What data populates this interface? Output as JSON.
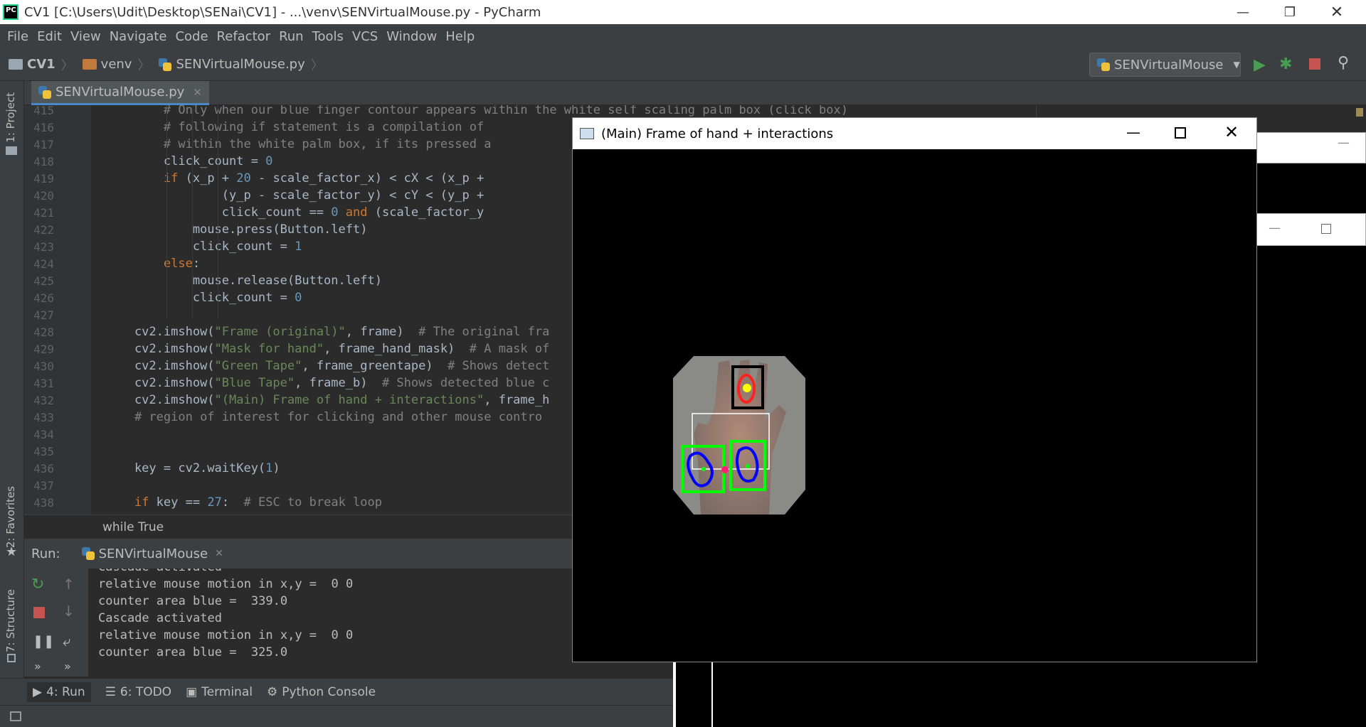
{
  "window": {
    "title": "CV1 [C:\\Users\\Udit\\Desktop\\SENai\\CV1] - ...\\venv\\SENVirtualMouse.py - PyCharm",
    "app_icon": "pycharm-logo-icon"
  },
  "menu": [
    "File",
    "Edit",
    "View",
    "Navigate",
    "Code",
    "Refactor",
    "Run",
    "Tools",
    "VCS",
    "Window",
    "Help"
  ],
  "breadcrumbs": [
    "CV1",
    "venv",
    "SENVirtualMouse.py"
  ],
  "run_config": "SENVirtualMouse",
  "side_tabs": {
    "project": "1: Project",
    "favorites": "2: Favorites",
    "structure": "7: Structure"
  },
  "editor": {
    "tab": "SENVirtualMouse.py",
    "lines": [
      {
        "n": "415",
        "html": "        <span class='cm'># Only when our blue finger contour appears within the white self scaling palm box (click box)</span>"
      },
      {
        "n": "416",
        "html": "        <span class='cm'># following if statement is a compilation of</span>"
      },
      {
        "n": "417",
        "html": "        <span class='cm'># within the white palm box, if its pressed a</span>"
      },
      {
        "n": "418",
        "html": "        click_count = <span class='nm'>0</span>"
      },
      {
        "n": "419",
        "html": "        <span class='kw'>if</span> (x_p + <span class='nm'>20</span> - scale_factor_x) &lt; cX &lt; (x_p +"
      },
      {
        "n": "420",
        "html": "                (y_p - scale_factor_y) &lt; cY &lt; (y_p +"
      },
      {
        "n": "421",
        "html": "                click_count == <span class='nm'>0</span> <span class='kw'>and</span> (scale_factor_y"
      },
      {
        "n": "422",
        "html": "            mouse.press(Button.left)"
      },
      {
        "n": "423",
        "html": "            click_count = <span class='nm'>1</span>"
      },
      {
        "n": "424",
        "html": "        <span class='kw'>else</span>:"
      },
      {
        "n": "425",
        "html": "            mouse.release(Button.left)"
      },
      {
        "n": "426",
        "html": "            click_count = <span class='nm'>0</span>"
      },
      {
        "n": "427",
        "html": ""
      },
      {
        "n": "428",
        "html": "    cv2.imshow(<span class='st'>\"Frame (original)\"</span>, frame)  <span class='cm'># The original fra</span>"
      },
      {
        "n": "429",
        "html": "    cv2.imshow(<span class='st'>\"Mask for hand\"</span>, frame_hand_mask)  <span class='cm'># A mask of</span>"
      },
      {
        "n": "430",
        "html": "    cv2.imshow(<span class='st'>\"Green Tape\"</span>, frame_greentape)  <span class='cm'># Shows detect</span>"
      },
      {
        "n": "431",
        "html": "    cv2.imshow(<span class='st'>\"Blue Tape\"</span>, frame_b)  <span class='cm'># Shows detected blue c</span>"
      },
      {
        "n": "432",
        "html": "    cv2.imshow(<span class='st'>\"(Main) Frame of hand + interactions\"</span>, frame_h"
      },
      {
        "n": "433",
        "html": "    <span class='cm'># region of interest for clicking and other mouse contro</span>"
      },
      {
        "n": "434",
        "html": ""
      },
      {
        "n": "435",
        "html": ""
      },
      {
        "n": "436",
        "html": "    key = cv2.waitKey(<span class='nm'>1</span>)"
      },
      {
        "n": "437",
        "html": ""
      },
      {
        "n": "438",
        "html": "    <span class='kw'>if</span> key == <span class='nm'>27</span>:  <span class='cm'># ESC to break loop</span>"
      }
    ]
  },
  "code_breadcrumb": "while True",
  "run_panel": {
    "label": "Run:",
    "tab": "SENVirtualMouse",
    "output": [
      "Cascade activated",
      "relative mouse motion in x,y =  0 0",
      "counter area blue =  339.0",
      "Cascade activated",
      "relative mouse motion in x,y =  0 0",
      "counter area blue =  325.0"
    ]
  },
  "bottom_tabs": [
    {
      "label": "4: Run",
      "icon": "run-icon"
    },
    {
      "label": "6: TODO",
      "icon": "todo-icon"
    },
    {
      "label": "Terminal",
      "icon": "terminal-icon"
    },
    {
      "label": "Python Console",
      "icon": "python-console-icon"
    }
  ],
  "cv_window": {
    "title": "(Main) Frame of hand + interactions"
  },
  "colors": {
    "accent": "#4a88c7",
    "run_green": "#499c54",
    "stop_red": "#c75450",
    "green_box": "#00ff00",
    "blue_contour": "#0000ff"
  }
}
